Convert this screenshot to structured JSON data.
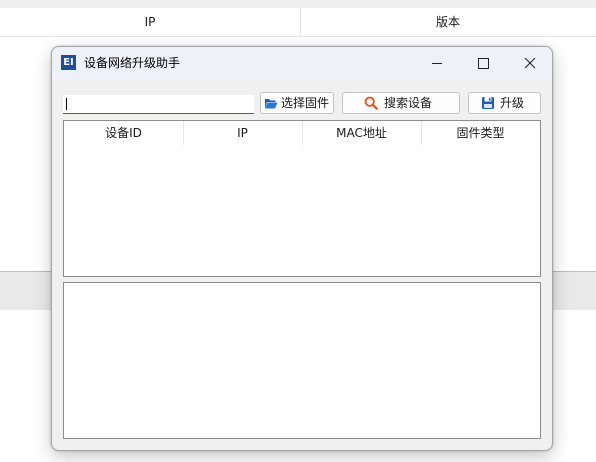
{
  "background": {
    "columns": [
      {
        "label": "IP"
      },
      {
        "label": "版本"
      }
    ]
  },
  "dialog": {
    "title": "设备网络升级助手",
    "app_icon_text": "EI",
    "firmware_path": {
      "value": "",
      "placeholder": ""
    },
    "buttons": {
      "select_firmware": {
        "label": "选择固件",
        "icon": "folder-open-icon"
      },
      "search_devices": {
        "label": "搜索设备",
        "icon": "search-icon"
      },
      "upgrade": {
        "label": "升级",
        "icon": "save-icon"
      }
    },
    "table": {
      "columns": [
        "设备ID",
        "IP",
        "MAC地址",
        "固件类型"
      ],
      "rows": []
    },
    "log_text": ""
  }
}
